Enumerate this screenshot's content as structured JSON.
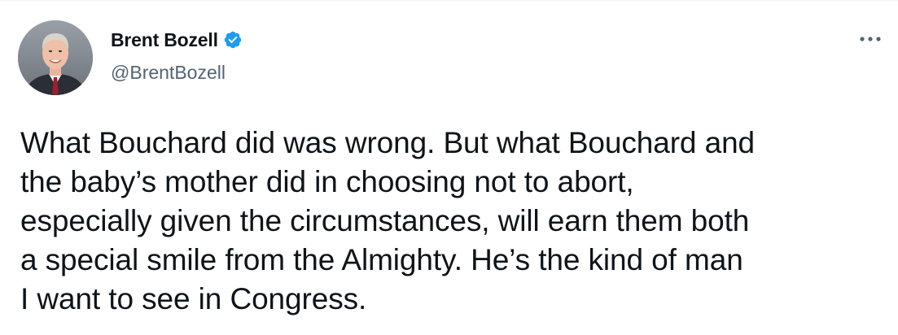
{
  "tweet": {
    "author": {
      "display_name": "Brent Bozell",
      "handle": "@BrentBozell",
      "verified": true,
      "avatar_icon": "profile-photo"
    },
    "more_icon": "ellipsis-icon",
    "text": "What Bouchard did was wrong.  But what Bouchard and\nthe baby’s mother did in choosing not to abort,\nespecially given the circumstances, will earn them both\na special smile from the Almighty. He’s the kind of man\nI want to see in Congress."
  },
  "colors": {
    "text": "#0f1419",
    "secondary_text": "#536471",
    "verified_badge": "#1d9bf0",
    "background": "#ffffff"
  }
}
